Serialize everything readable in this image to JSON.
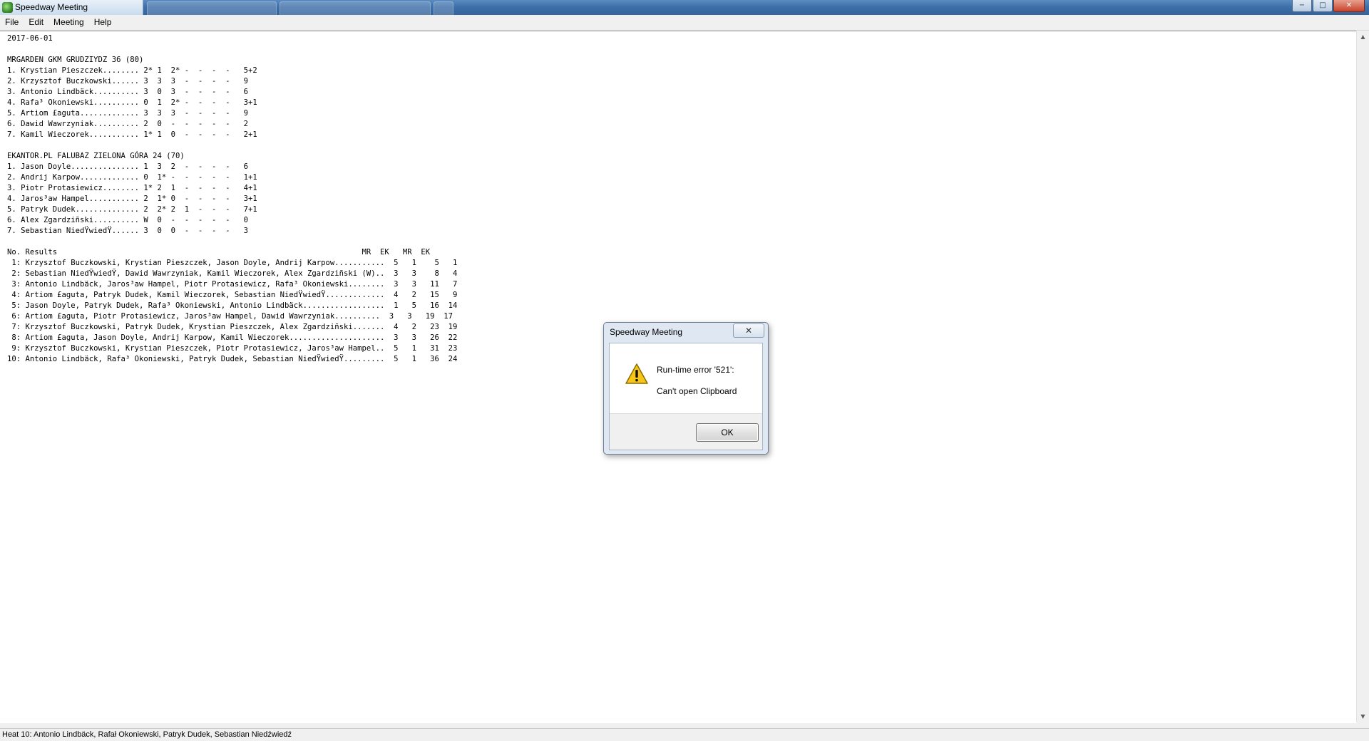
{
  "window": {
    "title": "Speedway Meeting"
  },
  "menu": {
    "items": [
      "File",
      "Edit",
      "Meeting",
      "Help"
    ]
  },
  "document": {
    "lines": [
      "2017-06-01",
      "",
      "MRGARDEN GKM GRUDZIYDZ 36 (80)",
      "1. Krystian Pieszczek........ 2* 1  2* -  -  -  -   5+2",
      "2. Krzysztof Buczkowski...... 3  3  3  -  -  -  -   9",
      "3. Antonio Lindbäck.......... 3  0  3  -  -  -  -   6",
      "4. Rafa³ Okoniewski.......... 0  1  2* -  -  -  -   3+1",
      "5. Artiom £aguta............. 3  3  3  -  -  -  -   9",
      "6. Dawid Wawrzyniak.......... 2  0  -  -  -  -  -   2",
      "7. Kamil Wieczorek........... 1* 1  0  -  -  -  -   2+1",
      "",
      "EKANTOR.PL FALUBAZ ZIELONA GÓRA 24 (70)",
      "1. Jason Doyle............... 1  3  2  -  -  -  -   6",
      "2. Andrij Karpow............. 0  1* -  -  -  -  -   1+1",
      "3. Piotr Protasiewicz........ 1* 2  1  -  -  -  -   4+1",
      "4. Jaros³aw Hampel........... 2  1* 0  -  -  -  -   3+1",
      "5. Patryk Dudek.............. 2  2* 2  1  -  -  -   7+1",
      "6. Alex Zgardziñski.......... W  0  -  -  -  -  -   0",
      "7. Sebastian NiedŸwiedŸ...... 3  0  0  -  -  -  -   3",
      "",
      "No. Results                                                                   MR  EK   MR  EK",
      " 1: Krzysztof Buczkowski, Krystian Pieszczek, Jason Doyle, Andrij Karpow...........  5   1    5   1",
      " 2: Sebastian NiedŸwiedŸ, Dawid Wawrzyniak, Kamil Wieczorek, Alex Zgardziñski (W)..  3   3    8   4",
      " 3: Antonio Lindbäck, Jaros³aw Hampel, Piotr Protasiewicz, Rafa³ Okoniewski........  3   3   11   7",
      " 4: Artiom £aguta, Patryk Dudek, Kamil Wieczorek, Sebastian NiedŸwiedŸ.............  4   2   15   9",
      " 5: Jason Doyle, Patryk Dudek, Rafa³ Okoniewski, Antonio Lindbäck..................  1   5   16  14",
      " 6: Artiom £aguta, Piotr Protasiewicz, Jaros³aw Hampel, Dawid Wawrzyniak..........  3   3   19  17",
      " 7: Krzysztof Buczkowski, Patryk Dudek, Krystian Pieszczek, Alex Zgardziñski.......  4   2   23  19",
      " 8: Artiom £aguta, Jason Doyle, Andrij Karpow, Kamil Wieczorek.....................  3   3   26  22",
      " 9: Krzysztof Buczkowski, Krystian Pieszczek, Piotr Protasiewicz, Jaros³aw Hampel..  5   1   31  23",
      "10: Antonio Lindbäck, Rafa³ Okoniewski, Patryk Dudek, Sebastian NiedŸwiedŸ.........  5   1   36  24"
    ]
  },
  "statusbar": {
    "text": "Heat 10:  Antonio Lindbäck, Rafał Okoniewski, Patryk Dudek, Sebastian Niedźwiedź"
  },
  "dialog": {
    "title": "Speedway Meeting",
    "close_label": "✕",
    "message_line1": "Run-time error '521':",
    "message_line2": "Can't open Clipboard",
    "ok_label": "OK",
    "icon": "warning-icon"
  },
  "colors": {
    "titlebar": "#3f6fa8",
    "warning_yellow": "#f5c518"
  }
}
